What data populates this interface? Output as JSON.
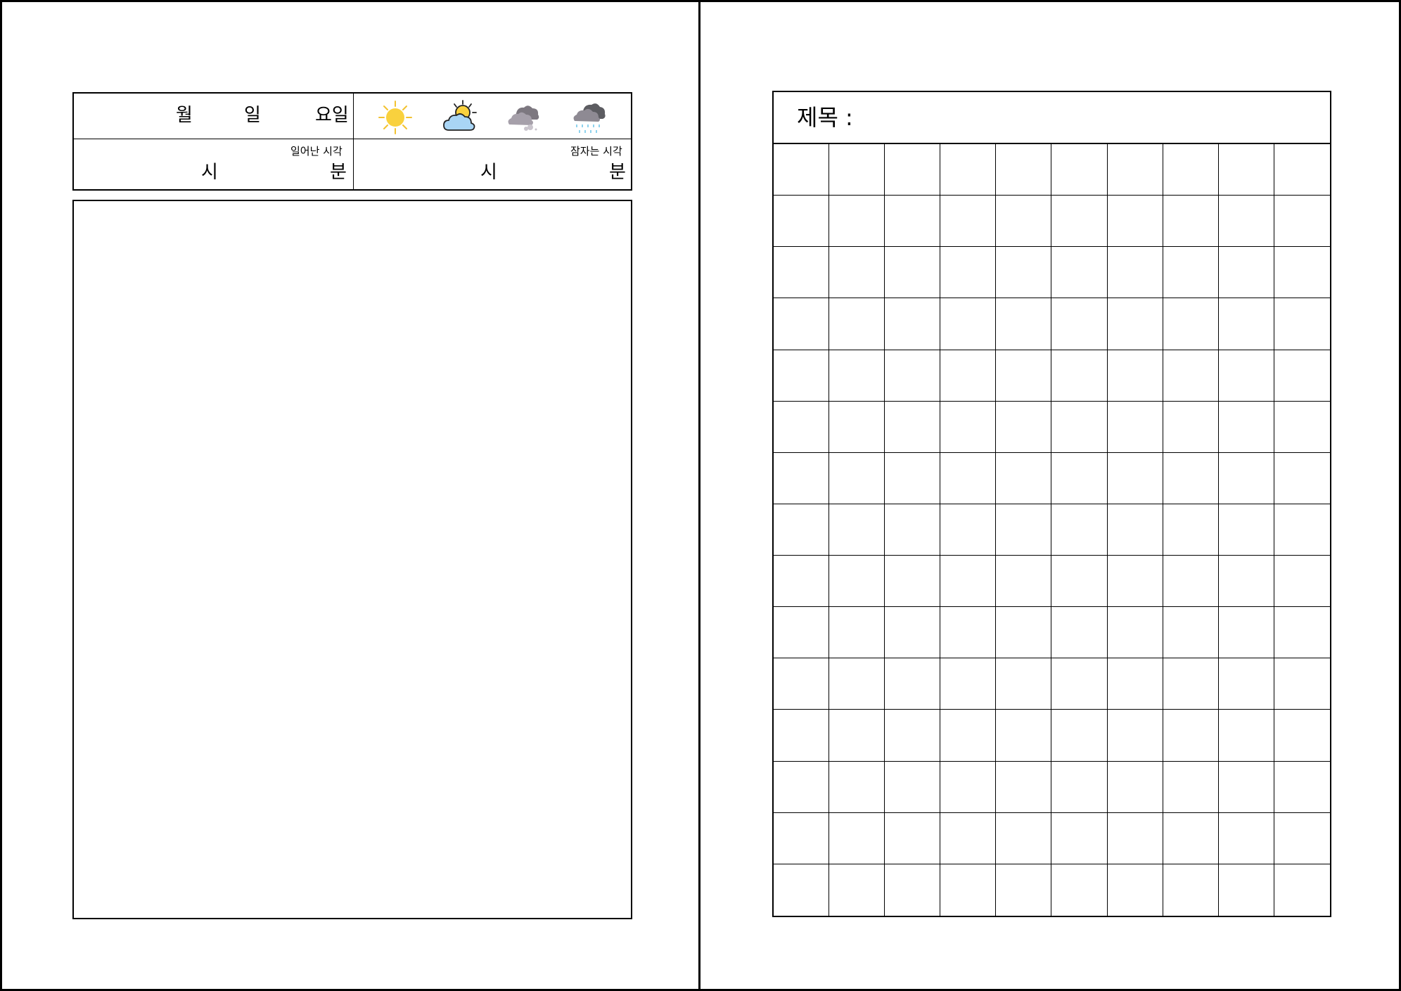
{
  "diary": {
    "date": {
      "month_label": "월",
      "day_label": "일",
      "weekday_label": "요일"
    },
    "weather_icons": [
      "sunny-icon",
      "partly-cloudy-icon",
      "cloudy-icon",
      "rainy-icon"
    ],
    "wake_time": {
      "caption": "일어난 시각",
      "hour_label": "시",
      "minute_label": "분"
    },
    "sleep_time": {
      "caption": "잠자는 시각",
      "hour_label": "시",
      "minute_label": "분"
    }
  },
  "manuscript": {
    "title_label": "제목 :",
    "columns": 10,
    "rows": 15
  },
  "colors": {
    "sun": "#F9D13E",
    "sun_ray": "#F2C230",
    "cloud_blue": "#A9D5F5",
    "cloud_gray": "#9E9AA3",
    "cloud_dark": "#6F6F74",
    "rain": "#8FD3EE"
  }
}
